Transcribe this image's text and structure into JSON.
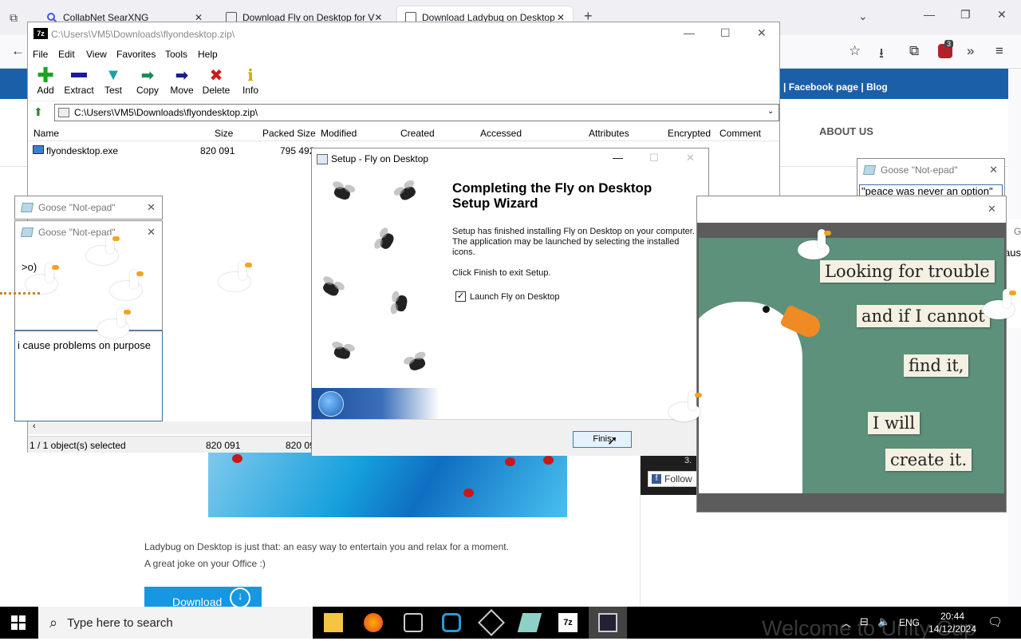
{
  "browser": {
    "tabs": [
      {
        "label": "CollabNet SearXNG",
        "active": false
      },
      {
        "label": "Download Fly on Desktop for V",
        "active": false
      },
      {
        "label": "Download Ladybug on Desktop",
        "active": true
      }
    ],
    "new_tab_label": "+",
    "extension_badge": "3"
  },
  "webpage": {
    "header_links": "| Facebook page | Blog",
    "about_us": "ABOUT US",
    "description_line1": "Ladybug on Desktop is just that: an easy way to entertain you and relax for a moment.",
    "description_line2": "A great joke on your Office :)",
    "download_label": "Download",
    "fb_count": "3.",
    "fb_follow": "Follow"
  },
  "sevenzip": {
    "title": "C:\\Users\\VM5\\Downloads\\flyondesktop.zip\\",
    "menu": [
      "File",
      "Edit",
      "View",
      "Favorites",
      "Tools",
      "Help"
    ],
    "toolbar": [
      {
        "label": "Add",
        "icon": "add-icon",
        "color": "#1aa51a"
      },
      {
        "label": "Extract",
        "icon": "extract-icon",
        "color": "#1a1aa0"
      },
      {
        "label": "Test",
        "icon": "test-icon",
        "color": "#1aa0a0"
      },
      {
        "label": "Copy",
        "icon": "copy-icon",
        "color": "#1a8a5a"
      },
      {
        "label": "Move",
        "icon": "move-icon",
        "color": "#1a1a90"
      },
      {
        "label": "Delete",
        "icon": "delete-icon",
        "color": "#d01a1a"
      },
      {
        "label": "Info",
        "icon": "info-icon",
        "color": "#d0b000"
      }
    ],
    "address": "C:\\Users\\VM5\\Downloads\\flyondesktop.zip\\",
    "columns": [
      "Name",
      "Size",
      "Packed Size",
      "Modified",
      "Created",
      "Accessed",
      "Attributes",
      "Encrypted",
      "Comment"
    ],
    "rows": [
      {
        "name": "flyondesktop.exe",
        "size": "820 091",
        "packed": "795 492"
      }
    ],
    "status": {
      "selected": "1 / 1 object(s) selected",
      "size": "820 091",
      "packed": "820 09"
    }
  },
  "setup": {
    "title": "Setup - Fly on Desktop",
    "heading": "Completing the Fly on Desktop Setup Wizard",
    "para1": "Setup has finished installing Fly on Desktop on your computer. The application may be launched by selecting the installed icons.",
    "para2": "Click Finish to exit Setup.",
    "launch_label": "Launch Fly on Desktop",
    "launch_checked": true,
    "finish_label": "Finis"
  },
  "notepads": [
    {
      "title": "Goose \"Not-epad\"",
      "text": ""
    },
    {
      "title": "Goose \"Not-epad\"",
      "text": ">o)"
    },
    {
      "title": "Goose \"Not-epad\"",
      "text": "\"peace was never an option\""
    }
  ],
  "notepad_text_area": "i cause problems on purpose",
  "meme": {
    "lines": [
      "Looking for trouble",
      "and if I cannot",
      "find it,",
      "I will",
      "create it."
    ]
  },
  "side_partial": {
    "label_g": "G",
    "label_aus": "aus"
  },
  "taskbar": {
    "search_placeholder": "Type here to search",
    "language": "ENG",
    "time": "20:44",
    "date": "14/12/2024",
    "watermark": "Welcome to Unity Cup"
  },
  "colors": {
    "site_blue": "#1a5fa8",
    "download_blue": "#1597e2",
    "meme_green": "#5d917b",
    "goose_beak": "#f2a41c"
  }
}
